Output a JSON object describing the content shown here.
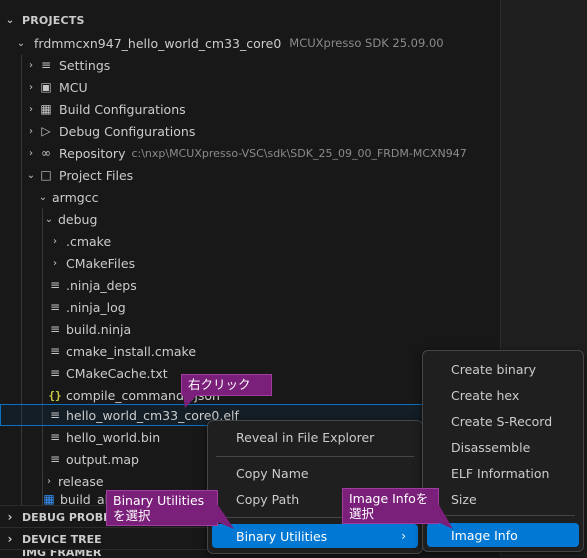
{
  "sections": {
    "projects": "PROJECTS",
    "debug_probes": "DEBUG PROBES",
    "device_tree": "DEVICE TREE",
    "bottom_partial": "IMG FRAMER"
  },
  "project": {
    "name": "frdmmcxn947_hello_world_cm33_core0",
    "sdk": "MCUXpresso SDK 25.09.00"
  },
  "tree": {
    "settings": "Settings",
    "mcu": "MCU",
    "build_configurations": "Build Configurations",
    "debug_configurations": "Debug Configurations",
    "repository": "Repository",
    "repository_path": "c:\\nxp\\MCUXpresso-VSC\\sdk\\SDK_25_09_00_FRDM-MCXN947",
    "project_files": "Project Files",
    "armgcc": "armgcc",
    "debug": "debug",
    "cmake": ".cmake",
    "cmakefiles": "CMakeFiles",
    "ninja_deps": ".ninja_deps",
    "ninja_log": ".ninja_log",
    "build_ninja": "build.ninja",
    "cmake_install": "cmake_install.cmake",
    "cmakecache": "CMakeCache.txt",
    "compile_commands": "compile_commands.json",
    "elf": "hello_world_cm33_core0.elf",
    "bin": "hello_world.bin",
    "map": "output.map",
    "release": "release",
    "build_all": "build_all"
  },
  "context_menu": {
    "reveal": "Reveal in File Explorer",
    "copy_name": "Copy Name",
    "copy_path": "Copy Path",
    "binary_utilities": "Binary Utilities"
  },
  "submenu": {
    "create_binary": "Create binary",
    "create_hex": "Create hex",
    "create_srecord": "Create S-Record",
    "disassemble": "Disassemble",
    "elf_information": "ELF Information",
    "size": "Size",
    "image_info": "Image Info"
  },
  "callouts": {
    "right_click": "右クリック",
    "binary_utilities_line1": "Binary Utilities",
    "binary_utilities_line2": "を選択",
    "image_info_line1": "Image Infoを",
    "image_info_line2": "選択"
  },
  "colors": {
    "accent": "#0078d4",
    "callout": "#7a1f7a",
    "json_icon": "#cbcb41"
  }
}
